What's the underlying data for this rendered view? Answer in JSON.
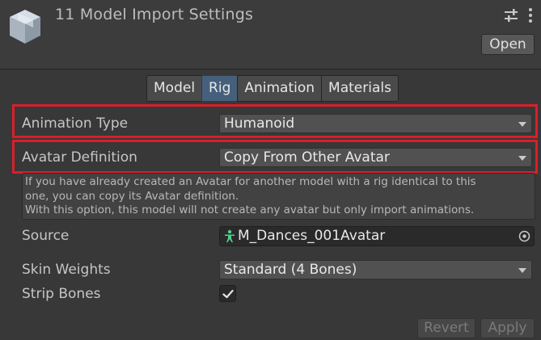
{
  "header": {
    "title": "11 Model Import Settings",
    "open_label": "Open",
    "icons": [
      "model-cube-icon",
      "preset-settings-icon",
      "more-options-icon"
    ]
  },
  "tabs": [
    {
      "label": "Model",
      "active": false
    },
    {
      "label": "Rig",
      "active": true
    },
    {
      "label": "Animation",
      "active": false
    },
    {
      "label": "Materials",
      "active": false
    }
  ],
  "rig": {
    "animation_type_label": "Animation Type",
    "animation_type_value": "Humanoid",
    "avatar_definition_label": "Avatar Definition",
    "avatar_definition_value": "Copy From Other Avatar",
    "help_lines": [
      "If you have already created an Avatar for another model with a rig identical to this",
      "one, you can copy its Avatar definition.",
      "With this option, this model will not create any avatar but only import animations."
    ],
    "source_label": "Source",
    "source_value": "M_Dances_001Avatar",
    "skin_weights_label": "Skin Weights",
    "skin_weights_value": "Standard (4 Bones)",
    "strip_bones_label": "Strip Bones",
    "strip_bones_checked": true
  },
  "footer": {
    "revert_label": "Revert",
    "apply_label": "Apply"
  },
  "colors": {
    "highlight": "#d81f2a",
    "active_tab": "#46607c",
    "avatar_icon": "#4fd18a"
  }
}
